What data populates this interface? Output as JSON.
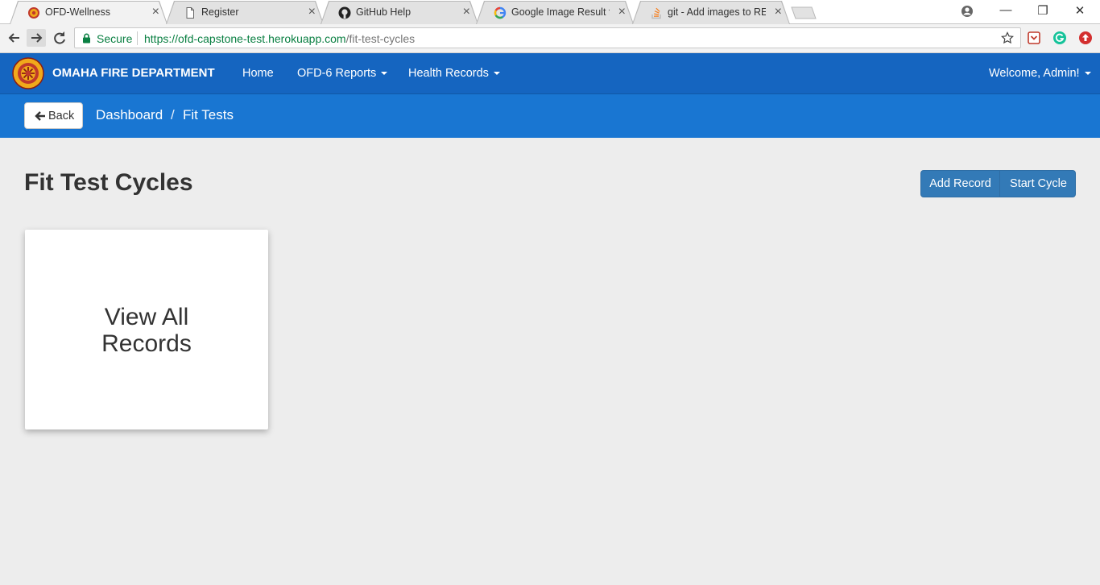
{
  "browser": {
    "tabs": [
      {
        "title": "OFD-Wellness",
        "icon": "ofd-badge-icon",
        "active": true
      },
      {
        "title": "Register",
        "icon": "document-icon",
        "active": false
      },
      {
        "title": "GitHub Help",
        "icon": "github-icon",
        "active": false
      },
      {
        "title": "Google Image Result for",
        "icon": "google-icon",
        "active": false
      },
      {
        "title": "git - Add images to READ",
        "icon": "stackoverflow-icon",
        "active": false
      }
    ],
    "close_glyph": "×",
    "window_controls": {
      "minimize": "—",
      "restore": "❐",
      "close": "✕"
    },
    "address_bar": {
      "secure_label": "Secure",
      "url_host": "https://ofd-capstone-test.herokuapp.com",
      "url_path": "/fit-test-cycles"
    },
    "colors": {
      "secure_green": "#0b8043"
    }
  },
  "navbar": {
    "brand": "OMAHA FIRE DEPARTMENT",
    "links": {
      "home": "Home",
      "reports": "OFD-6 Reports",
      "health": "Health Records"
    },
    "user_menu": "Welcome, Admin!",
    "colors": {
      "background": "#1565c0"
    }
  },
  "breadcrumb_bar": {
    "back_label": "Back",
    "crumbs": [
      "Dashboard",
      "Fit Tests"
    ],
    "separator": "/",
    "colors": {
      "background": "#1976d2"
    }
  },
  "main": {
    "title": "Fit Test Cycles",
    "actions": {
      "add_record": "Add Record",
      "start_cycle": "Start Cycle"
    },
    "card": {
      "line1": "View All",
      "line2": "Records"
    },
    "colors": {
      "primary_button": "#337ab7",
      "page_background": "#ededed"
    }
  }
}
